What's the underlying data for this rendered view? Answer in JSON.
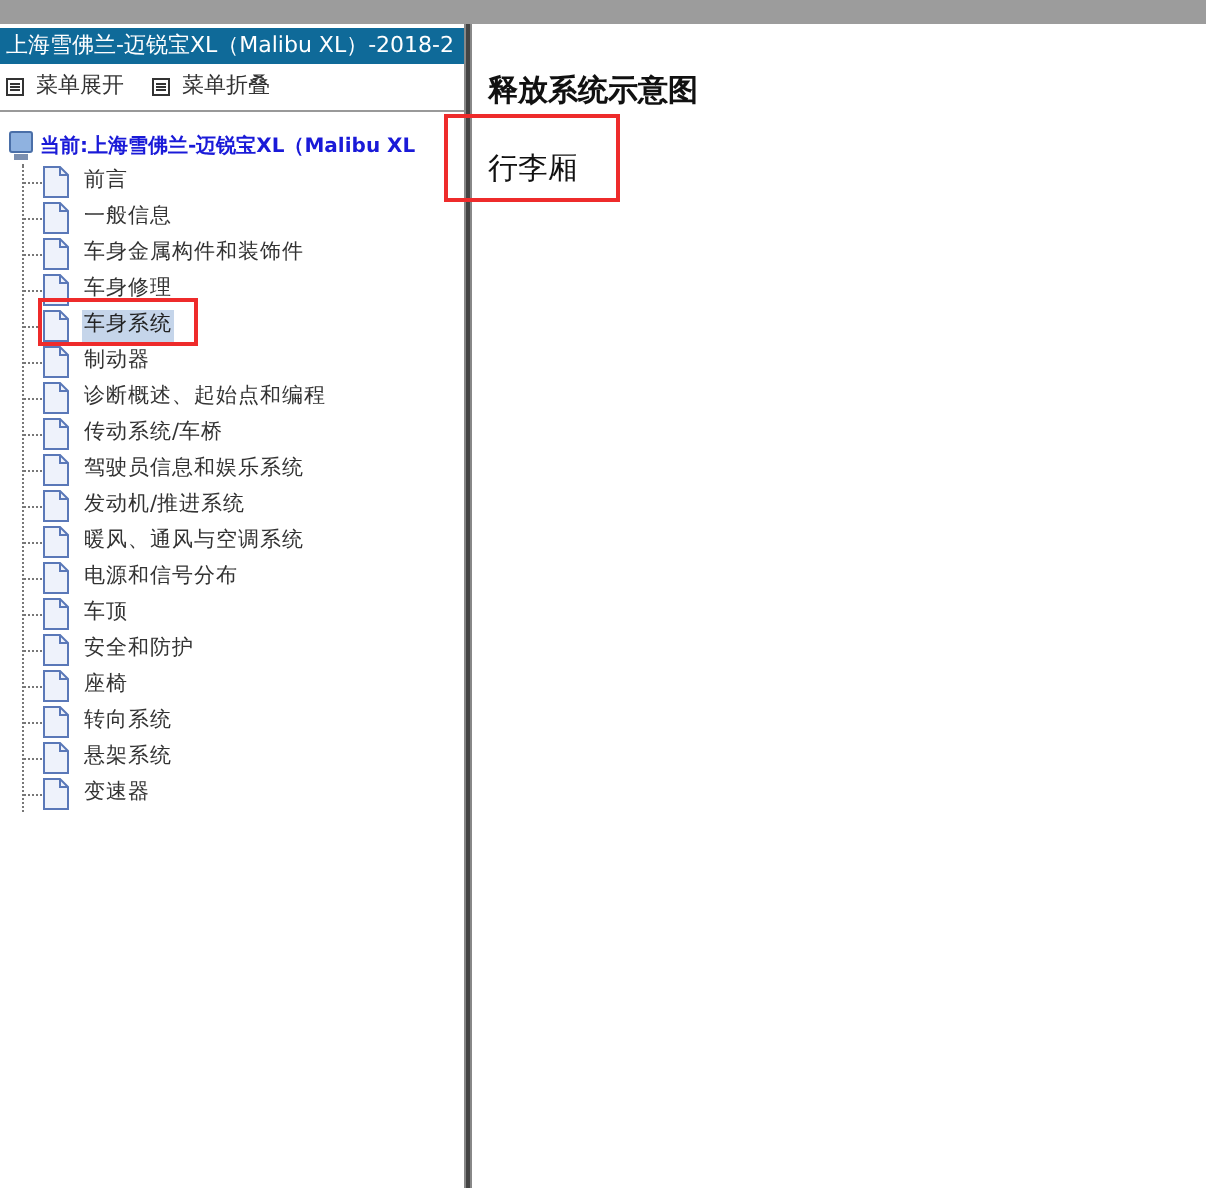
{
  "panel_title": "上海雪佛兰-迈锐宝XL（Malibu XL）-2018-2",
  "toolbar": [
    {
      "label": "菜单展开"
    },
    {
      "label": "菜单折叠"
    }
  ],
  "tree": {
    "label": "当前:上海雪佛兰-迈锐宝XL（Malibu XL",
    "children": [
      {
        "label": "前言",
        "selected": false,
        "marked": false
      },
      {
        "label": "一般信息",
        "selected": false,
        "marked": false
      },
      {
        "label": "车身金属构件和装饰件",
        "selected": false,
        "marked": false
      },
      {
        "label": "车身修理",
        "selected": false,
        "marked": false
      },
      {
        "label": "车身系统",
        "selected": true,
        "marked": true
      },
      {
        "label": "制动器",
        "selected": false,
        "marked": false
      },
      {
        "label": "诊断概述、起始点和编程",
        "selected": false,
        "marked": false
      },
      {
        "label": "传动系统/车桥",
        "selected": false,
        "marked": false
      },
      {
        "label": "驾驶员信息和娱乐系统",
        "selected": false,
        "marked": false
      },
      {
        "label": "发动机/推进系统",
        "selected": false,
        "marked": false
      },
      {
        "label": "暖风、通风与空调系统",
        "selected": false,
        "marked": false
      },
      {
        "label": "电源和信号分布",
        "selected": false,
        "marked": false
      },
      {
        "label": "车顶",
        "selected": false,
        "marked": false
      },
      {
        "label": "安全和防护",
        "selected": false,
        "marked": false
      },
      {
        "label": "座椅",
        "selected": false,
        "marked": false
      },
      {
        "label": "转向系统",
        "selected": false,
        "marked": false
      },
      {
        "label": "悬架系统",
        "selected": false,
        "marked": false
      },
      {
        "label": "变速器",
        "selected": false,
        "marked": false
      }
    ]
  },
  "content": {
    "title": "释放系统示意图",
    "label": {
      "text": "行李厢",
      "marked": true
    }
  }
}
